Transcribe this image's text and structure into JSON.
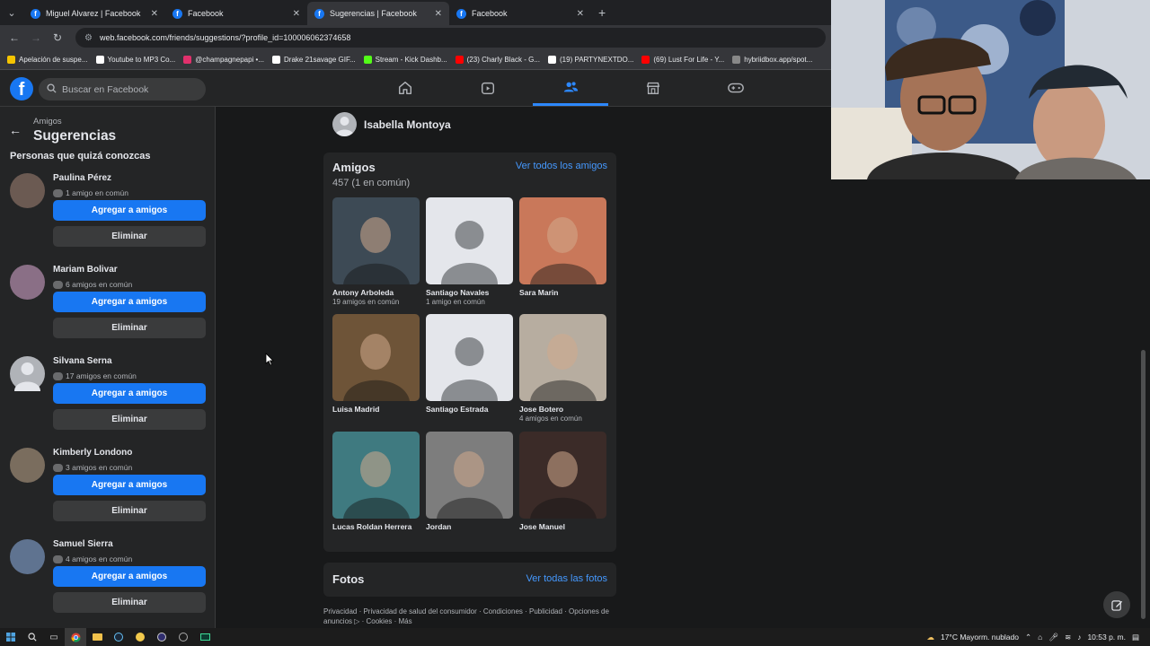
{
  "browser": {
    "tabs": [
      {
        "title": "Miguel Alvarez | Facebook",
        "active": false
      },
      {
        "title": "Facebook",
        "active": false
      },
      {
        "title": "Sugerencias | Facebook",
        "active": true
      },
      {
        "title": "Facebook",
        "active": false
      }
    ],
    "url": "web.facebook.com/friends/suggestions/?profile_id=100006062374658",
    "bookmarks": [
      {
        "label": "Apelación de suspe...",
        "color": "#f5c400"
      },
      {
        "label": "Youtube to MP3 Co...",
        "color": "#ffffff"
      },
      {
        "label": "@champagnepapi •...",
        "color": "#e1306c"
      },
      {
        "label": "Drake 21savage GIF...",
        "color": "#ffffff"
      },
      {
        "label": "Stream - Kick Dashb...",
        "color": "#53fc18"
      },
      {
        "label": "(23) Charly Black - G...",
        "color": "#ff0000"
      },
      {
        "label": "(19) PARTYNEXTDO...",
        "color": "#ffffff"
      },
      {
        "label": "(69) Lust For Life - Y...",
        "color": "#ff0000"
      },
      {
        "label": "hybriidbox.app/spot...",
        "color": "#888888"
      }
    ]
  },
  "header": {
    "search_placeholder": "Buscar en Facebook",
    "logo_letter": "f"
  },
  "sidebar": {
    "breadcrumb": "Amigos",
    "title": "Sugerencias",
    "section_title": "Personas que quizá conozcas",
    "add_label": "Agregar a amigos",
    "remove_label": "Eliminar",
    "suggestions": [
      {
        "name": "Paulina Pérez",
        "mutual": "1 amigo en común",
        "color": "#6b5a52"
      },
      {
        "name": "Mariam Bolivar",
        "mutual": "6 amigos en común",
        "color": "#8a6f86"
      },
      {
        "name": "Silvana Serna",
        "mutual": "17 amigos en común",
        "color": "#b0b3b8"
      },
      {
        "name": "Kimberly Londono",
        "mutual": "3 amigos en común",
        "color": "#7a6d5e"
      },
      {
        "name": "Samuel Sierra",
        "mutual": "4 amigos en común",
        "color": "#5f7390"
      }
    ]
  },
  "profile": {
    "name": "Isabella Montoya"
  },
  "friends_card": {
    "title": "Amigos",
    "see_all": "Ver todos los amigos",
    "count": "457 (1 en común)",
    "friends": [
      {
        "name": "Antony Arboleda",
        "mutual": "19 amigos en común",
        "color": "#3d4a55",
        "placeholder": false
      },
      {
        "name": "Santiago Navales",
        "mutual": "1 amigo en común",
        "color": "#e4e6eb",
        "placeholder": true
      },
      {
        "name": "Sara Marin",
        "mutual": "",
        "color": "#c9785a",
        "placeholder": false
      },
      {
        "name": "Luisa Madrid",
        "mutual": "",
        "color": "#6e5438",
        "placeholder": false
      },
      {
        "name": "Santiago Estrada",
        "mutual": "",
        "color": "#e4e6eb",
        "placeholder": true
      },
      {
        "name": "Jose Botero",
        "mutual": "4 amigos en común",
        "color": "#b7ada0",
        "placeholder": false
      },
      {
        "name": "Lucas Roldan Herrera",
        "mutual": "",
        "color": "#3f7a80",
        "placeholder": false
      },
      {
        "name": "Jordan",
        "mutual": "",
        "color": "#7d7d7d",
        "placeholder": false
      },
      {
        "name": "Jose Manuel",
        "mutual": "",
        "color": "#3b2b28",
        "placeholder": false
      }
    ]
  },
  "photos_card": {
    "title": "Fotos",
    "see_all": "Ver todas las fotos"
  },
  "footer": {
    "links": "Privacidad · Privacidad de salud del consumidor · Condiciones · Publicidad · Opciones de anuncios ▷ · Cookies · Más"
  },
  "taskbar": {
    "weather": "17°C  Mayorm. nublado",
    "time": "10:53 p. m."
  },
  "colors": {
    "accent": "#1877f2",
    "link": "#4599ff",
    "background": "#18191a",
    "surface": "#242526"
  }
}
